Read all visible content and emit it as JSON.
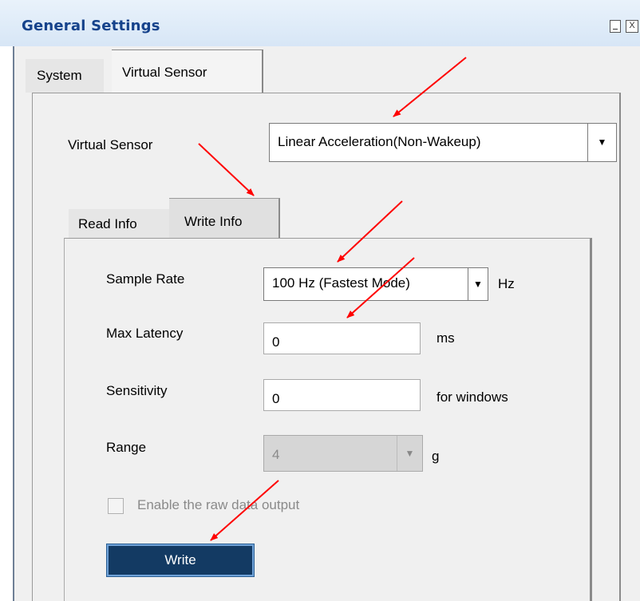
{
  "window": {
    "title": "General Settings",
    "close_glyph": "X"
  },
  "tabs": {
    "system": "System",
    "virtual_sensor": "Virtual Sensor"
  },
  "virtual_sensor": {
    "label": "Virtual Sensor",
    "selected": "Linear Acceleration(Non-Wakeup)"
  },
  "subtabs": {
    "read": "Read Info",
    "write": "Write Info"
  },
  "form": {
    "sample_rate": {
      "label": "Sample Rate",
      "value": "100 Hz (Fastest Mode)",
      "unit": "Hz"
    },
    "max_latency": {
      "label": "Max Latency",
      "value": "0",
      "unit": "ms"
    },
    "sensitivity": {
      "label": "Sensitivity",
      "value": "0",
      "unit": "for windows"
    },
    "range": {
      "label": "Range",
      "value": "4",
      "unit": "g"
    },
    "raw_output": {
      "label": "Enable the raw data output",
      "checked": false
    },
    "write_button": "Write"
  },
  "icons": {
    "dropdown": "chevron-down-icon",
    "annotation": "red-arrow-icon"
  },
  "colors": {
    "title": "#15428b",
    "button_bg": "#133a63",
    "annotation_arrow": "#ff0000"
  }
}
